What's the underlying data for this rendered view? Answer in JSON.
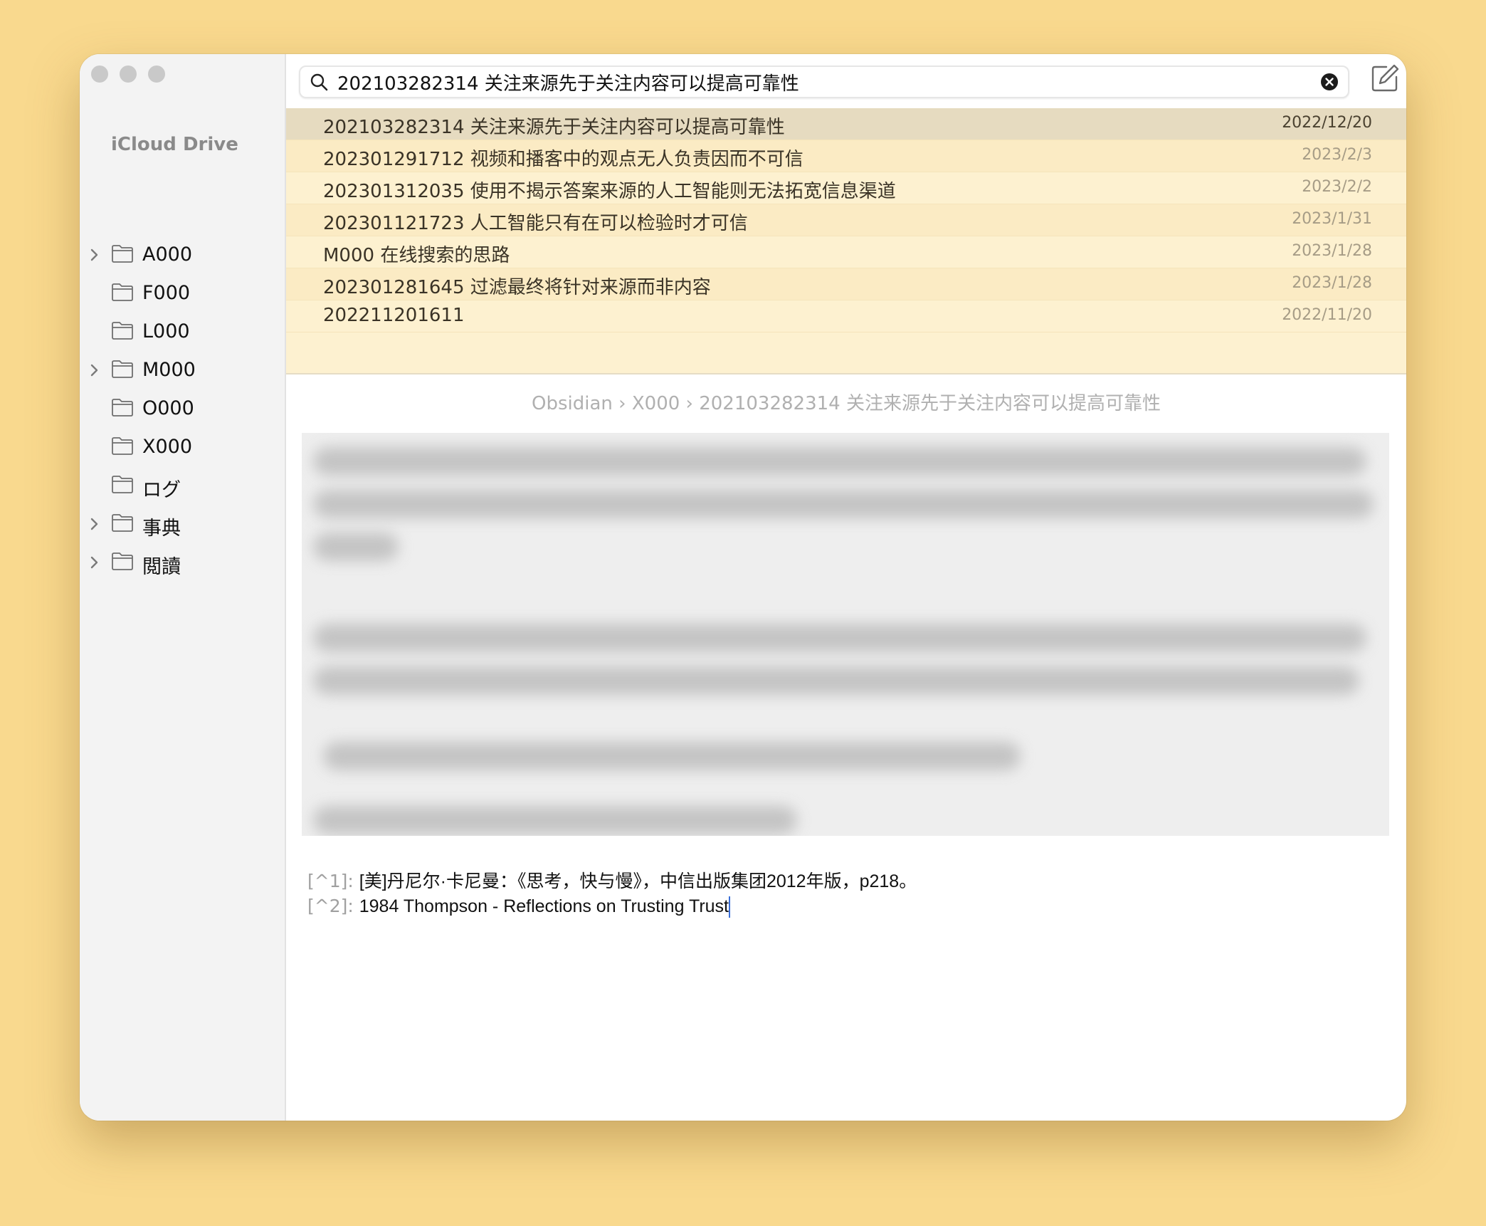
{
  "sidebar": {
    "title": "iCloud Drive",
    "folders": [
      {
        "label": "A000",
        "expandable": true
      },
      {
        "label": "F000",
        "expandable": false
      },
      {
        "label": "L000",
        "expandable": false
      },
      {
        "label": "M000",
        "expandable": true
      },
      {
        "label": "O000",
        "expandable": false
      },
      {
        "label": "X000",
        "expandable": false
      },
      {
        "label": "ログ",
        "expandable": false
      },
      {
        "label": "事典",
        "expandable": true
      },
      {
        "label": "閲讀",
        "expandable": true
      }
    ]
  },
  "search": {
    "value": "202103282314 关注来源先于关注内容可以提高可靠性"
  },
  "results": [
    {
      "title": "202103282314 关注来源先于关注内容可以提高可靠性",
      "date": "2022/12/20"
    },
    {
      "title": "202301291712 视频和播客中的观点无人负责因而不可信",
      "date": "2023/2/3"
    },
    {
      "title": "202301312035 使用不揭示答案来源的人工智能则无法拓宽信息渠道",
      "date": "2023/2/2"
    },
    {
      "title": "202301121723 人工智能只有在可以检验时才可信",
      "date": "2023/1/31"
    },
    {
      "title": "M000 在线搜索的思路",
      "date": "2023/1/28"
    },
    {
      "title": "202301281645 过滤最终将针对来源而非内容",
      "date": "2023/1/28"
    },
    {
      "title": "202211201611",
      "date": "2022/11/20"
    }
  ],
  "breadcrumb": "Obsidian › X000 › 202103282314 关注来源先于关注内容可以提高可靠性",
  "footnotes": [
    {
      "marker": "[^1]:",
      "text": "[美]丹尼尔·卡尼曼：《思考，快与慢》，中信出版集团2012年版，p218。"
    },
    {
      "marker": "[^2]:",
      "text": "1984 Thompson - Reflections on Trusting Trust"
    }
  ],
  "colors": {
    "background": "#f9d98e",
    "results_bg": "#fdf1d0",
    "selected_row": "#e6dbc0",
    "caret": "#3a6fd8"
  }
}
